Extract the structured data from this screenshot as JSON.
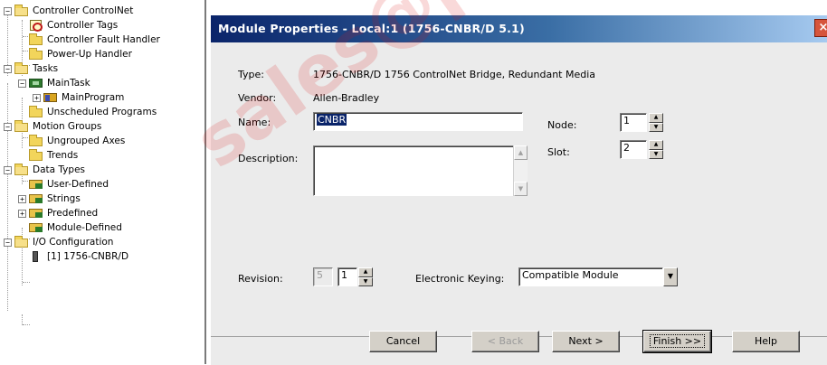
{
  "tree": {
    "items": [
      {
        "label": "Controller ControlNet",
        "icon": "folder-icon",
        "expander": "−"
      },
      {
        "label": "Controller Tags",
        "icon": "tags-icon",
        "expander": ""
      },
      {
        "label": "Controller Fault Handler",
        "icon": "folder-icon",
        "expander": ""
      },
      {
        "label": "Power-Up Handler",
        "icon": "folder-icon",
        "expander": ""
      },
      {
        "label": "Tasks",
        "icon": "folder-icon",
        "expander": "−"
      },
      {
        "label": "MainTask",
        "icon": "task-icon",
        "expander": "−"
      },
      {
        "label": "MainProgram",
        "icon": "program-icon",
        "expander": "+"
      },
      {
        "label": "Unscheduled Programs",
        "icon": "folder-icon",
        "expander": ""
      },
      {
        "label": "Motion Groups",
        "icon": "folder-icon",
        "expander": "−"
      },
      {
        "label": "Ungrouped Axes",
        "icon": "folder-icon",
        "expander": ""
      },
      {
        "label": "Trends",
        "icon": "folder-icon",
        "expander": ""
      },
      {
        "label": "Data Types",
        "icon": "folder-icon",
        "expander": "−"
      },
      {
        "label": "User-Defined",
        "icon": "datatype-icon",
        "expander": ""
      },
      {
        "label": "Strings",
        "icon": "datatype-icon",
        "expander": "+"
      },
      {
        "label": "Predefined",
        "icon": "datatype-icon",
        "expander": "+"
      },
      {
        "label": "Module-Defined",
        "icon": "datatype-icon",
        "expander": ""
      },
      {
        "label": "I/O Configuration",
        "icon": "folder-icon",
        "expander": "−"
      },
      {
        "label": "[1] 1756-CNBR/D",
        "icon": "io-module-icon",
        "expander": ""
      }
    ]
  },
  "dialog": {
    "title": "Module Properties - Local:1 (1756-CNBR/D 5.1)",
    "close_glyph": "×",
    "type_label": "Type:",
    "type_value": "1756-CNBR/D 1756 ControlNet Bridge, Redundant Media",
    "vendor_label": "Vendor:",
    "vendor_value": "Allen-Bradley",
    "name_label": "Name:",
    "name_value": "CNBR",
    "description_label": "Description:",
    "description_value": "",
    "node_label": "Node:",
    "node_value": "1",
    "slot_label": "Slot:",
    "slot_value": "2",
    "revision_label": "Revision:",
    "revision_major": "5",
    "revision_minor": "1",
    "keying_label": "Electronic Keying:",
    "keying_value": "Compatible Module"
  },
  "buttons": {
    "cancel": "Cancel",
    "back": "< Back",
    "next": "Next >",
    "finish": "Finish >>",
    "help": "Help"
  },
  "watermark": "sales@pc",
  "colors": {
    "titlebar_start": "#0a246a",
    "titlebar_end": "#a6caf0",
    "selection": "#0a246a",
    "dialog_bg": "#ebebeb"
  }
}
